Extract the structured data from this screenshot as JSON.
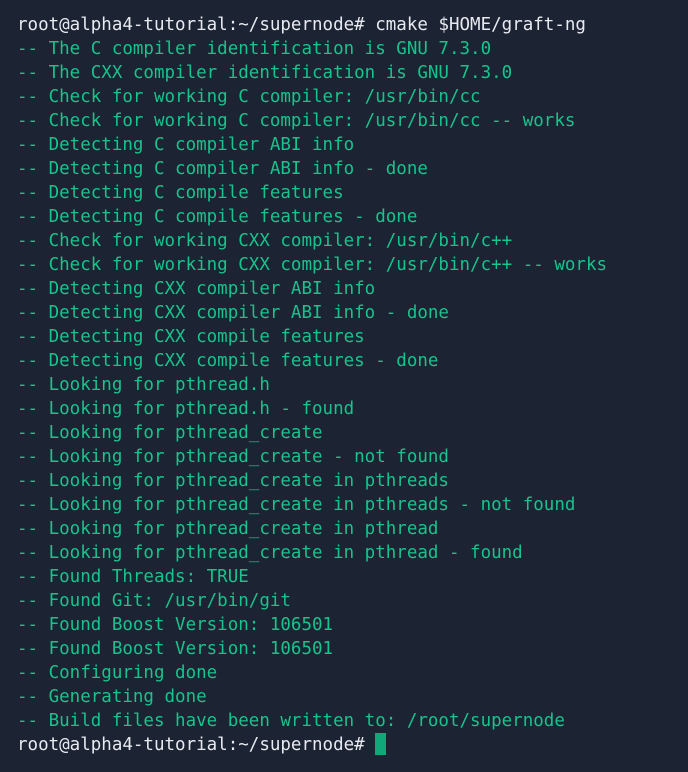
{
  "terminal": {
    "prompt": "root@alpha4-tutorial:~/supernode#",
    "command": "cmake $HOME/graft-ng",
    "output": [
      "-- The C compiler identification is GNU 7.3.0",
      "-- The CXX compiler identification is GNU 7.3.0",
      "-- Check for working C compiler: /usr/bin/cc",
      "-- Check for working C compiler: /usr/bin/cc -- works",
      "-- Detecting C compiler ABI info",
      "-- Detecting C compiler ABI info - done",
      "-- Detecting C compile features",
      "-- Detecting C compile features - done",
      "-- Check for working CXX compiler: /usr/bin/c++",
      "-- Check for working CXX compiler: /usr/bin/c++ -- works",
      "-- Detecting CXX compiler ABI info",
      "-- Detecting CXX compiler ABI info - done",
      "-- Detecting CXX compile features",
      "-- Detecting CXX compile features - done",
      "-- Looking for pthread.h",
      "-- Looking for pthread.h - found",
      "-- Looking for pthread_create",
      "-- Looking for pthread_create - not found",
      "-- Looking for pthread_create in pthreads",
      "-- Looking for pthread_create in pthreads - not found",
      "-- Looking for pthread_create in pthread",
      "-- Looking for pthread_create in pthread - found",
      "-- Found Threads: TRUE",
      "-- Found Git: /usr/bin/git",
      "-- Found Boost Version: 106501",
      "-- Found Boost Version: 106501",
      "-- Configuring done",
      "-- Generating done",
      "-- Build files have been written to: /root/supernode"
    ],
    "final_prompt": "root@alpha4-tutorial:~/supernode#"
  },
  "colors": {
    "background": "#1c2333",
    "output_text": "#18c38c",
    "prompt_text": "#e7eaf0",
    "cursor": "#10a878"
  }
}
